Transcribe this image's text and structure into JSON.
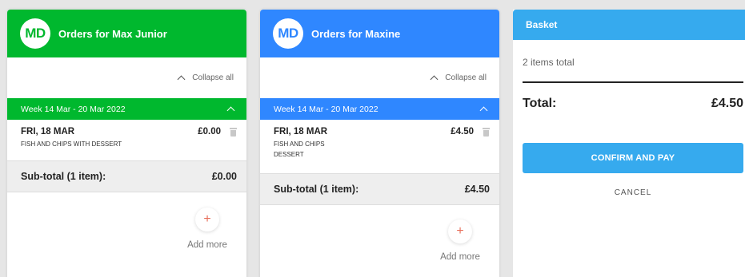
{
  "children": [
    {
      "initials": "MD",
      "title": "Orders for Max Junior",
      "collapse_label": "Collapse all",
      "week_label": "Week 14 Mar - 20 Mar 2022",
      "order": {
        "day": "FRI, 18 MAR",
        "price": "£0.00",
        "items": [
          "FISH AND CHIPS WITH DESSERT"
        ]
      },
      "subtotal_label": "Sub-total (1 item):",
      "subtotal_value": "£0.00",
      "add_more_icon": "+",
      "add_more_label": "Add more",
      "accent": "#00b82e"
    },
    {
      "initials": "MD",
      "title": "Orders for Maxine",
      "collapse_label": "Collapse all",
      "week_label": "Week 14 Mar - 20 Mar 2022",
      "order": {
        "day": "FRI, 18 MAR",
        "price": "£4.50",
        "items": [
          "FISH AND CHIPS",
          "DESSERT"
        ]
      },
      "subtotal_label": "Sub-total (1 item):",
      "subtotal_value": "£4.50",
      "add_more_icon": "+",
      "add_more_label": "Add more",
      "accent": "#2f87ff"
    }
  ],
  "basket": {
    "title": "Basket",
    "items_total": "2 items total",
    "total_label": "Total:",
    "total_value": "£4.50",
    "confirm_label": "CONFIRM AND PAY",
    "cancel_label": "CANCEL",
    "accent": "#36aaee"
  },
  "icons": {
    "collapse": "chevron-up-icon",
    "week_toggle": "chevron-up-icon",
    "delete": "trash-icon",
    "add": "plus-icon"
  }
}
